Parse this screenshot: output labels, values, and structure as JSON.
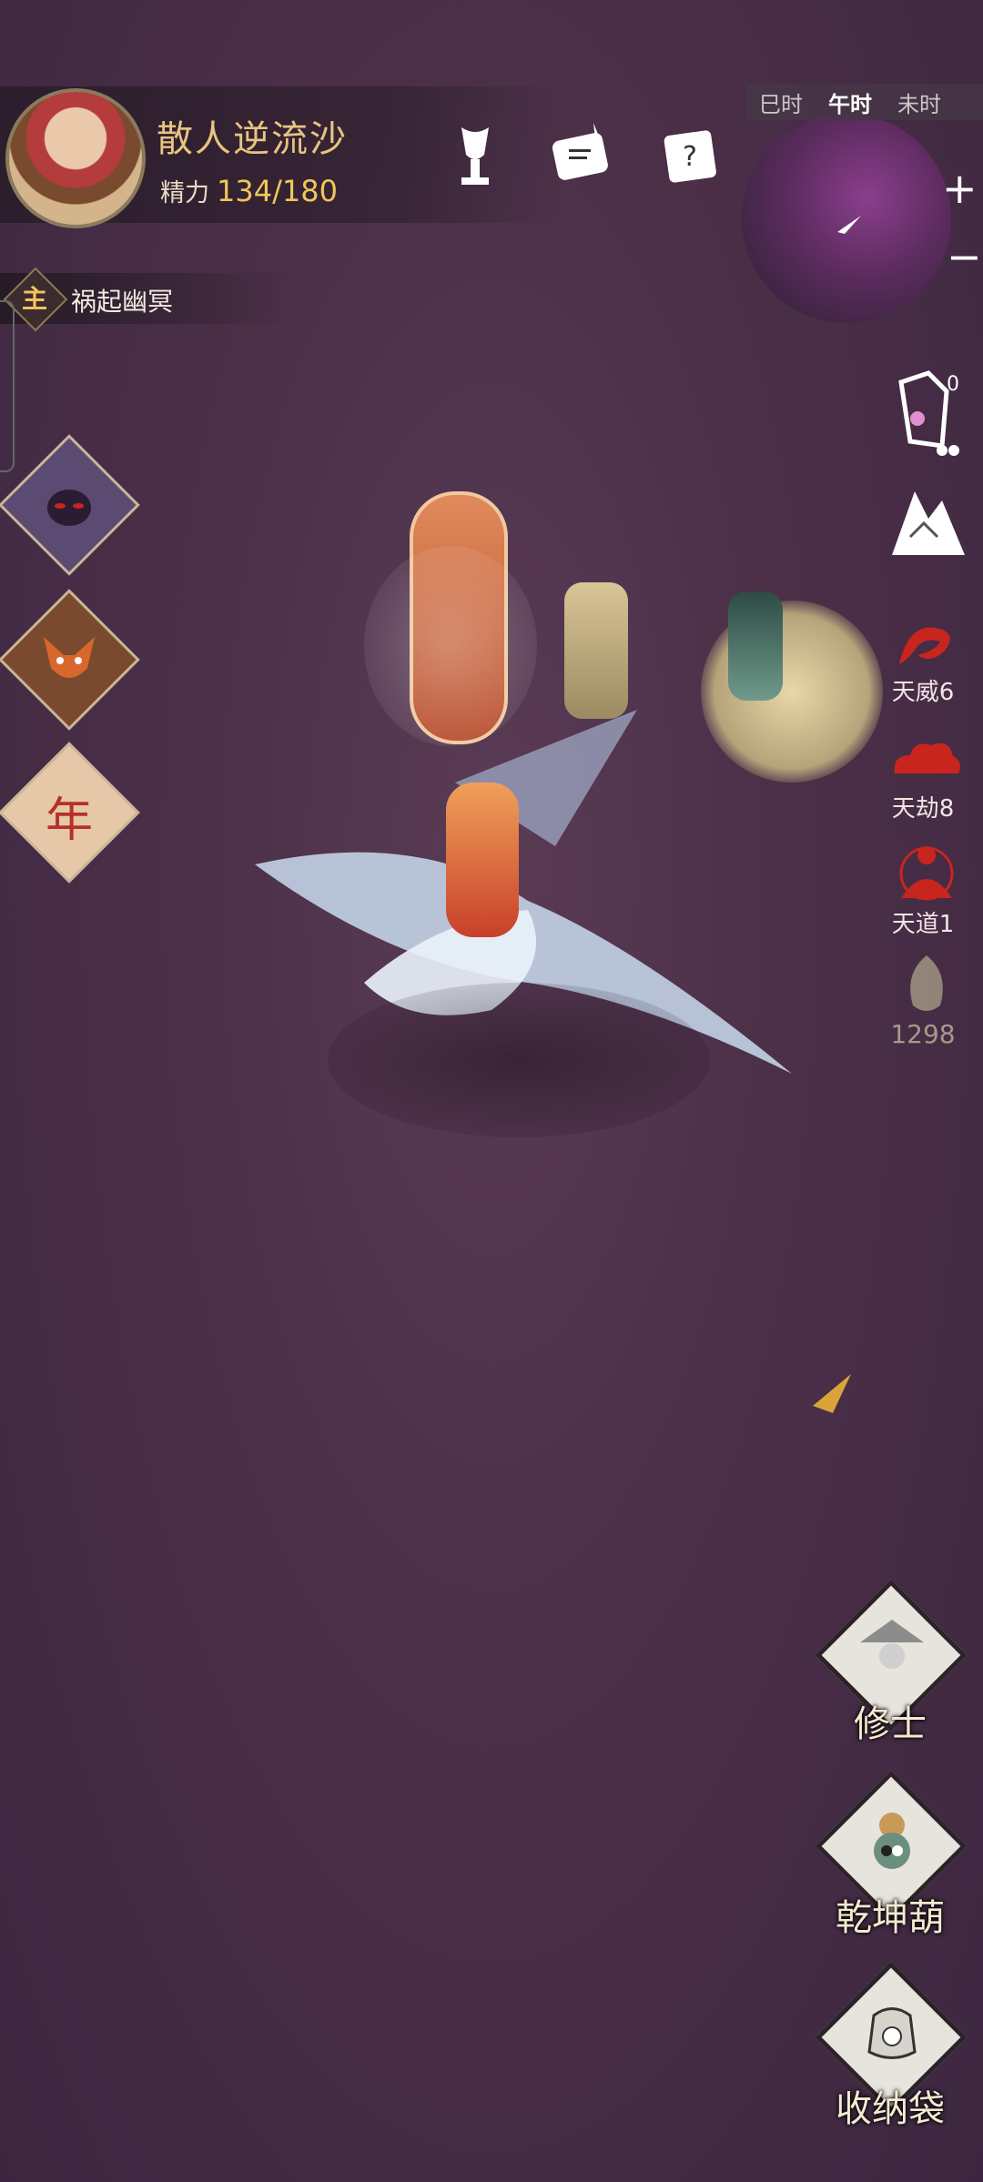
{
  "player": {
    "name": "散人逆流沙",
    "stamina_label": "精力",
    "stamina_value": "134/180"
  },
  "time_bar": {
    "items": [
      "巳时",
      "午时",
      "未时"
    ],
    "active": "午时"
  },
  "minimap": {
    "zoom_in": "+",
    "zoom_out": "−"
  },
  "quest": {
    "badge": "主",
    "name": "祸起幽冥"
  },
  "left_buttons": [
    {
      "icon": "demon-face-icon"
    },
    {
      "icon": "fox-mask-icon"
    },
    {
      "label": "年"
    }
  ],
  "top_icons": [
    "trophy-icon",
    "scroll-quest-icon",
    "question-scroll-icon"
  ],
  "right_status": [
    {
      "icon": "music-lantern-icon",
      "count": "0"
    },
    {
      "icon": "mountain-icon"
    },
    {
      "icon": "dragon-icon",
      "label": "天威6"
    },
    {
      "icon": "cloud-icon",
      "label": "天劫8"
    },
    {
      "icon": "meditate-icon",
      "label": "天道1"
    },
    {
      "icon": "spirit-icon",
      "label": "1298"
    }
  ],
  "bottom_buttons": [
    {
      "label": "修士",
      "icon": "cultivator-icon"
    },
    {
      "label": "乾坤葫",
      "icon": "gourd-icon"
    },
    {
      "label": "收纳袋",
      "icon": "bag-icon"
    }
  ],
  "colors": {
    "accent_gold": "#f0c65a",
    "danger_red": "#c8251e",
    "bg": "#4a2f47"
  }
}
